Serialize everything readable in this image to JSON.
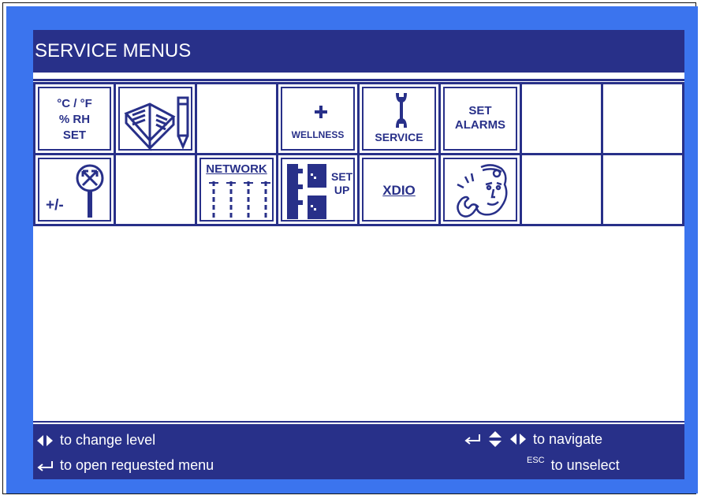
{
  "title": "SERVICE MENUS",
  "tiles": {
    "temp_units": [
      "°C / °F",
      "% RH",
      "SET"
    ],
    "wellness": "WELLNESS",
    "service": "SERVICE",
    "set_alarms": [
      "SET",
      "ALARMS"
    ],
    "offset": "+/-",
    "network": "NETWORK",
    "setup": [
      "SET",
      "UP"
    ],
    "xdio": "XDIO"
  },
  "footer": {
    "change_level": "to change level",
    "open_menu": "to open requested menu",
    "navigate": "to navigate",
    "esc": "ESC",
    "unselect": "to unselect"
  },
  "colors": {
    "navy": "#283089",
    "frame_blue": "#3b74ee",
    "white": "#ffffff"
  },
  "icons": [
    "book-pencil-icon",
    "plus-icon",
    "wrench-icon",
    "magnifier-icon",
    "network-icon",
    "setup-icon",
    "technician-icon",
    "arrow-left-right-icon",
    "enter-icon",
    "arrow-up-down-icon"
  ]
}
